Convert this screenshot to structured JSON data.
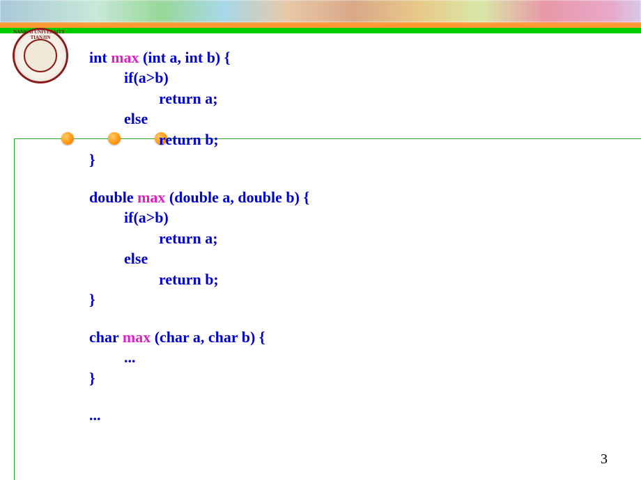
{
  "page_number": "3",
  "logo": {
    "ring_text": "NANKAI UNIVERSITY · TIANJIN"
  },
  "code": {
    "fn_name": "max",
    "sig1_pre": "int ",
    "sig1_post": " (int a, int b) {",
    "if_line": "if(a>b)",
    "ret_a": "return a;",
    "else_line": "else",
    "ret_b": "return b;",
    "close": "}",
    "sig2_pre": "double ",
    "sig2_post": " (double a, double b) {",
    "sig3_pre": "char ",
    "sig3_post": " (char a, char b) {",
    "ellipsis": "...",
    "trailing": "..."
  }
}
